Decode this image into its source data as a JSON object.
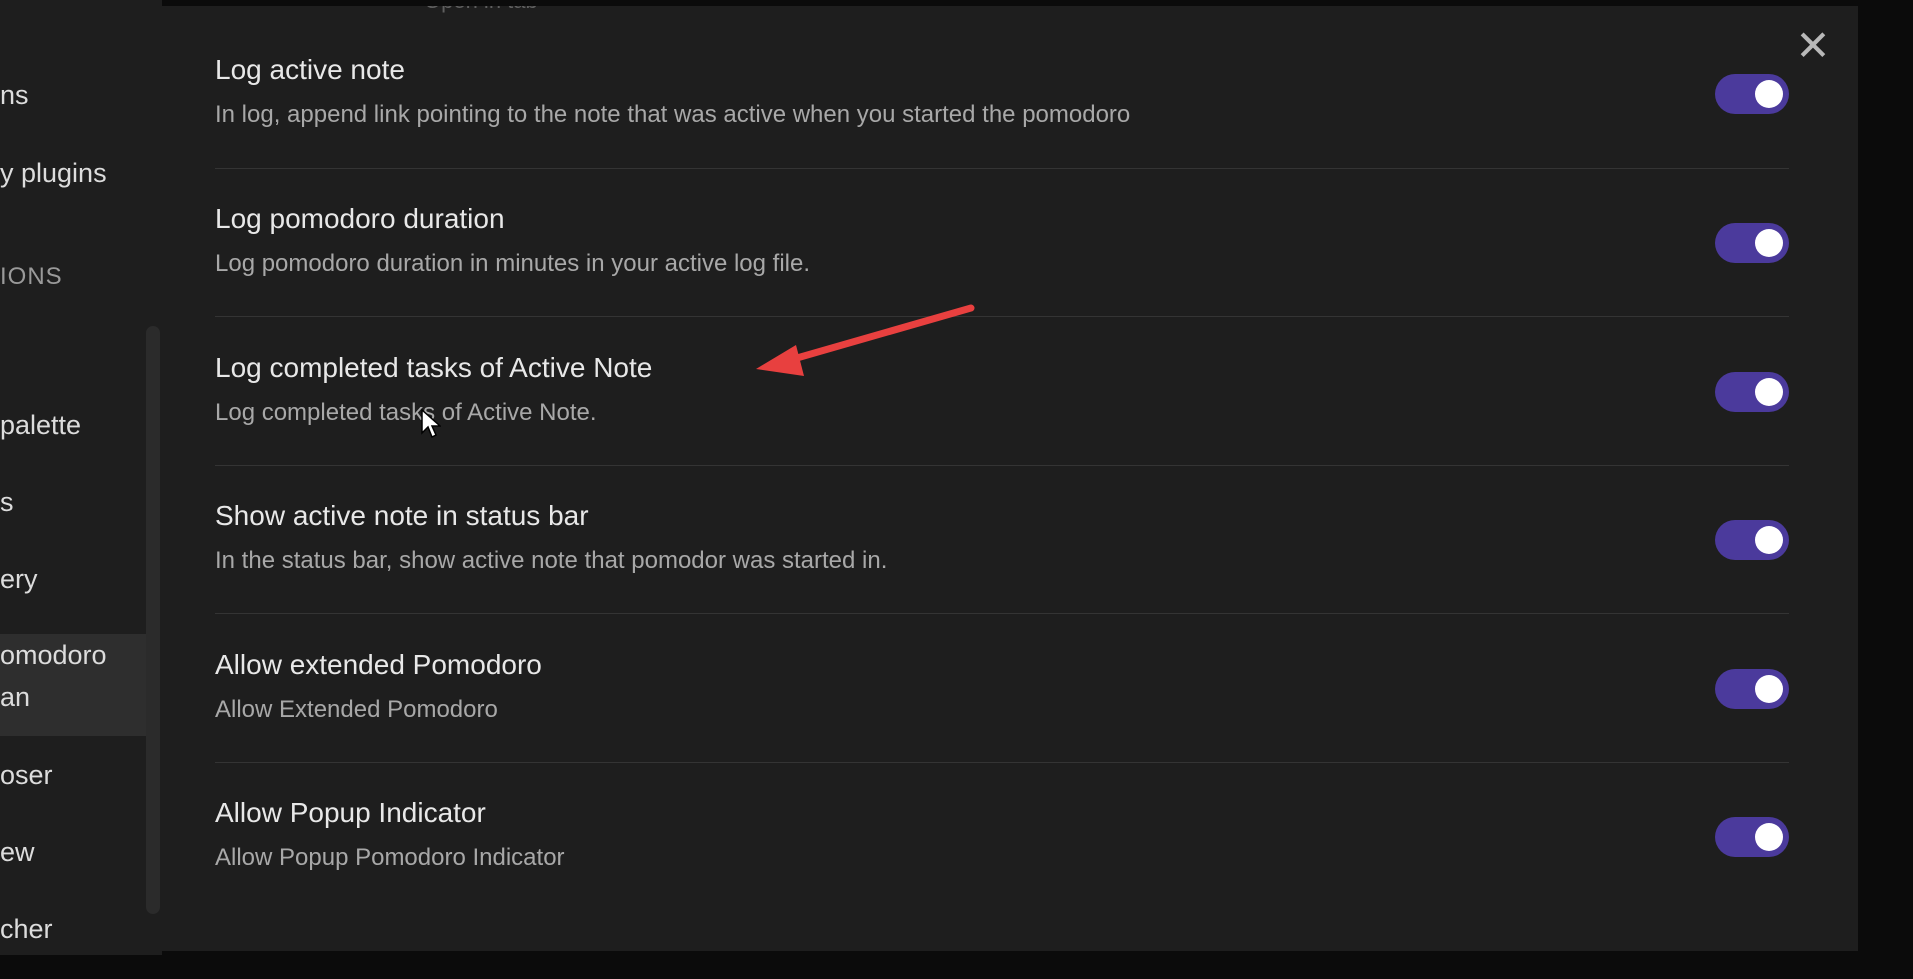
{
  "sidebar": {
    "items": [
      {
        "label": "ns"
      },
      {
        "label": "y plugins"
      },
      {
        "label": "IONS"
      },
      {
        "label": "palette"
      },
      {
        "label": "s"
      },
      {
        "label": "ery"
      },
      {
        "label": "omodoro"
      },
      {
        "label": "an"
      },
      {
        "label": "oser"
      },
      {
        "label": "ew"
      },
      {
        "label": "cher"
      }
    ]
  },
  "modal": {
    "ghost_text": "Open in tab",
    "close_icon": "close-icon",
    "settings": [
      {
        "name": "Log active note",
        "description": "In log, append link pointing to the note that was active when you started the pomodoro",
        "enabled": true
      },
      {
        "name": "Log pomodoro duration",
        "description": "Log pomodoro duration in minutes in your active log file.",
        "enabled": true
      },
      {
        "name": "Log completed tasks of Active Note",
        "description": "Log completed tasks of Active Note.",
        "enabled": true
      },
      {
        "name": "Show active note in status bar",
        "description": "In the status bar, show active note that pomodor was started in.",
        "enabled": true
      },
      {
        "name": "Allow extended Pomodoro",
        "description": "Allow Extended Pomodoro",
        "enabled": true
      },
      {
        "name": "Allow Popup Indicator",
        "description": "Allow Popup Pomodoro Indicator",
        "enabled": true
      }
    ]
  },
  "colors": {
    "toggle_on": "#4b3a9c",
    "annotation_arrow": "#e8403f",
    "background": "#1e1e1e"
  }
}
